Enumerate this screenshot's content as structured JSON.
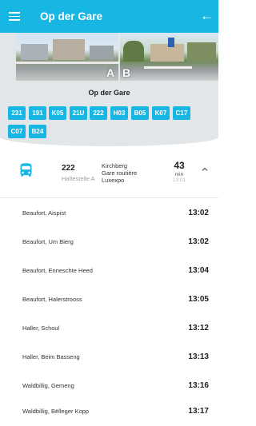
{
  "app_bar": {
    "title": "Op der Gare",
    "menu_icon": "hamburger-menu-icon",
    "back_icon": "arrow-left-icon",
    "back_glyph": "←"
  },
  "colors": {
    "accent": "#18b6e2",
    "panel": "#e3e6e8"
  },
  "stop": {
    "name": "Op der Gare",
    "photos": [
      {
        "letter": "A"
      },
      {
        "letter": "B"
      }
    ],
    "lines": [
      "231",
      "191",
      "K05",
      "21U",
      "222",
      "H03",
      "B05",
      "K07",
      "C17",
      "C07",
      "B24"
    ]
  },
  "route": {
    "number": "222",
    "platform": "Haltestelle A",
    "destination": [
      "Kirchberg",
      "Gare routière",
      "Luxexpo"
    ],
    "minutes": "43",
    "minutes_label": "min",
    "departure_time": "13:01",
    "expand_icon": "chevron-up-icon",
    "vehicle_icon": "bus-icon"
  },
  "stops": [
    {
      "name": "Beaufort, Aispist",
      "time": "13:02"
    },
    {
      "name": "Beaufort, Um Bierg",
      "time": "13:02"
    },
    {
      "name": "Beaufort, Enneschte Heed",
      "time": "13:04"
    },
    {
      "name": "Beaufort, Halerstrooss",
      "time": "13:05"
    },
    {
      "name": "Haller, Schoul",
      "time": "13:12"
    },
    {
      "name": "Haller, Beim Basseng",
      "time": "13:13"
    },
    {
      "name": "Waldbillig, Gemeng",
      "time": "13:16"
    },
    {
      "name": "Waldbillig, Bëlleger Kopp",
      "time": "13:17"
    }
  ]
}
